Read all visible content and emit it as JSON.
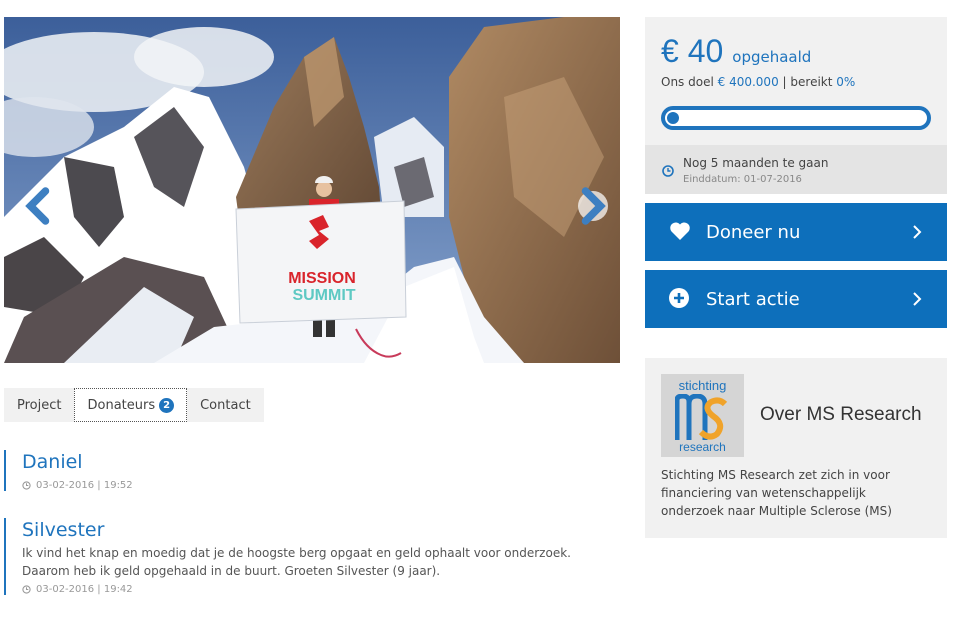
{
  "campaign": {
    "amount": "€ 40",
    "amount_label": "opgehaald",
    "goal_prefix": "Ons doel",
    "goal_amount": "€ 400.000",
    "goal_separator": "|",
    "reached_label": "bereikt",
    "reached_percent": "0%",
    "progress_fraction": 0.0,
    "deadline_text": "Nog 5 maanden te gaan",
    "deadline_date": "Einddatum: 01-07-2016"
  },
  "actions": {
    "donate_label": "Doneer nu",
    "start_label": "Start actie"
  },
  "tabs": [
    {
      "label": "Project",
      "active": false
    },
    {
      "label": "Donateurs",
      "badge": "2",
      "active": true
    },
    {
      "label": "Contact",
      "active": false
    }
  ],
  "donors": [
    {
      "name": "Daniel",
      "message": "",
      "date": "03-02-2016 | 19:52"
    },
    {
      "name": "Silvester",
      "message": "Ik vind het knap en moedig dat je de hoogste berg opgaat en geld ophaalt voor onderzoek. Daarom heb ik geld opgehaald in de buurt. Groeten Silvester (9 jaar).",
      "date": "03-02-2016 | 19:42"
    }
  ],
  "hero": {
    "banner_line1": "MISSION",
    "banner_line2": "SUMMIT"
  },
  "organization": {
    "logo_top": "stichting",
    "logo_bottom": "research",
    "title": "Over MS Research",
    "description": "Stichting MS Research zet zich in voor financiering van wetenschappelijk onderzoek naar Multiple Sclerose (MS)"
  },
  "colors": {
    "accent": "#1f74bd",
    "cta": "#0d6fbb",
    "panel": "#f1f1f1"
  },
  "icons": {
    "prev": "chevron-left-icon",
    "next": "chevron-right-icon",
    "clock": "clock-icon",
    "donate": "heart-icon",
    "start": "plus-circle-icon",
    "go": "chevron-right-icon"
  }
}
